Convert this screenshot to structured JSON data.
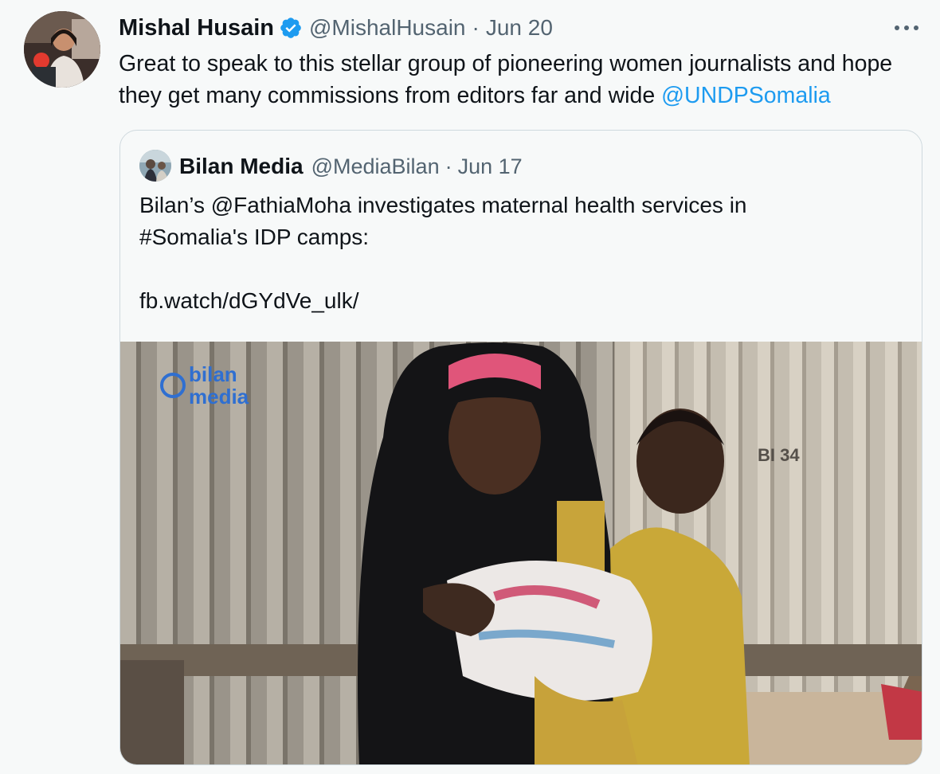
{
  "tweet": {
    "author_name": "Mishal Husain",
    "author_handle": "@MishalHusain",
    "separator": "·",
    "date": "Jun 20",
    "text_part1": "Great to speak to this stellar group of pioneering women journalists and hope they get many commissions from editors far and wide ",
    "mention": "@UNDPSomalia",
    "icons": {
      "verified": "verified-badge-icon",
      "more": "more-options-icon"
    },
    "colors": {
      "link": "#1d9bf0",
      "verified": "#1d9bf0",
      "secondary_text": "#536471"
    }
  },
  "quote": {
    "author_name": "Bilan Media",
    "author_handle": "@MediaBilan",
    "separator": "·",
    "date": "Jun 17",
    "line1": "Bilan’s @FathiaMoha investigates maternal health services in",
    "line2": "#Somalia's IDP camps:",
    "link": "fb.watch/dGYdVe_ulk/",
    "media_watermark_line1": "bilan",
    "media_watermark_line2": "media",
    "wall_marking": "BI 34"
  }
}
